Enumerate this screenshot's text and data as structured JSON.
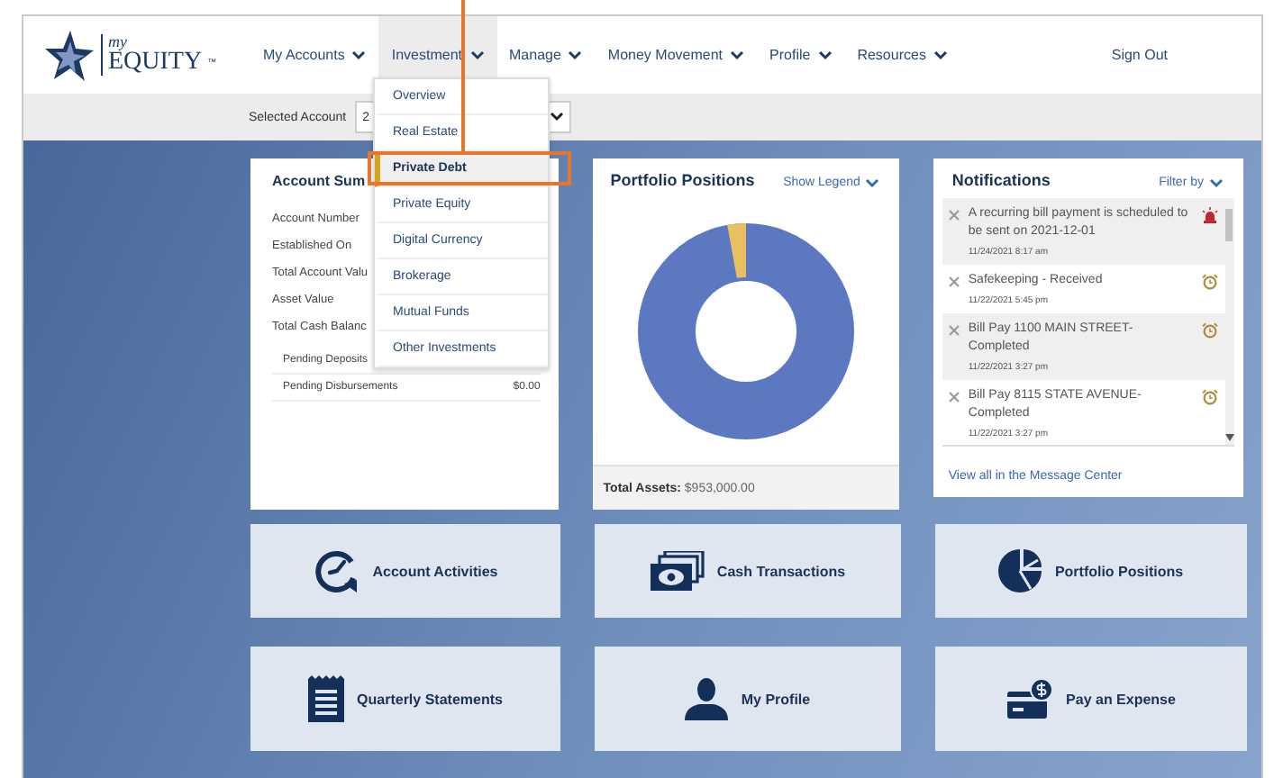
{
  "logo": {
    "tagline": "my",
    "brand": "EQUITY",
    "mark": "™"
  },
  "nav": [
    {
      "label": "My Accounts",
      "selected": false
    },
    {
      "label": "Investment",
      "selected": true
    },
    {
      "label": "Manage",
      "selected": false
    },
    {
      "label": "Money Movement",
      "selected": false
    },
    {
      "label": "Profile",
      "selected": false
    },
    {
      "label": "Resources",
      "selected": false
    }
  ],
  "sign_out": "Sign Out",
  "selected_account": {
    "label": "Selected Account",
    "value": "2"
  },
  "investment_menu": [
    {
      "label": "Overview",
      "selected": false
    },
    {
      "label": "Real Estate",
      "selected": false
    },
    {
      "label": "Private Debt",
      "selected": true
    },
    {
      "label": "Private Equity",
      "selected": false
    },
    {
      "label": "Digital Currency",
      "selected": false
    },
    {
      "label": "Brokerage",
      "selected": false
    },
    {
      "label": "Mutual Funds",
      "selected": false
    },
    {
      "label": "Other Investments",
      "selected": false
    }
  ],
  "callout": {
    "shown": true
  },
  "account_summary": {
    "title": "Account Sum",
    "rows": [
      {
        "label": "Account Number"
      },
      {
        "label": "Established On"
      },
      {
        "label": "Total Account Valu"
      },
      {
        "label": "Asset Value"
      },
      {
        "label": "Total Cash Balanc"
      }
    ],
    "sub_rows": [
      {
        "label": "Pending Deposits"
      },
      {
        "label": "Pending Disbursements",
        "value": "$0.00"
      }
    ]
  },
  "portfolio": {
    "title": "Portfolio Positions",
    "legend_toggle": "Show Legend",
    "total_label": "Total Assets:",
    "total_value": "$953,000.00"
  },
  "notifications": {
    "title": "Notifications",
    "filter": "Filter by",
    "items": [
      {
        "text": "A recurring bill payment is scheduled to be sent on 2021-12-01",
        "time": "11/24/2021 8:17 am",
        "kind": "alert"
      },
      {
        "text": "Safekeeping - Received",
        "time": "11/22/2021 5:45 pm",
        "kind": "reminder"
      },
      {
        "text": "Bill Pay 1100 MAIN STREET- Completed",
        "time": "11/22/2021 3:27 pm",
        "kind": "reminder"
      },
      {
        "text": "Bill Pay 8115 STATE AVENUE- Completed",
        "time": "11/22/2021 3:27 pm",
        "kind": "reminder"
      }
    ],
    "footer_link": "View all in the Message Center"
  },
  "tiles": [
    {
      "label": "Account Activities",
      "kind": "activities"
    },
    {
      "label": "Cash Transactions",
      "kind": "cash"
    },
    {
      "label": "Portfolio Positions",
      "kind": "pie"
    },
    {
      "label": "Quarterly Statements",
      "kind": "statement"
    },
    {
      "label": "My Profile",
      "kind": "profile"
    },
    {
      "label": "Pay an Expense",
      "kind": "expense"
    }
  ]
}
